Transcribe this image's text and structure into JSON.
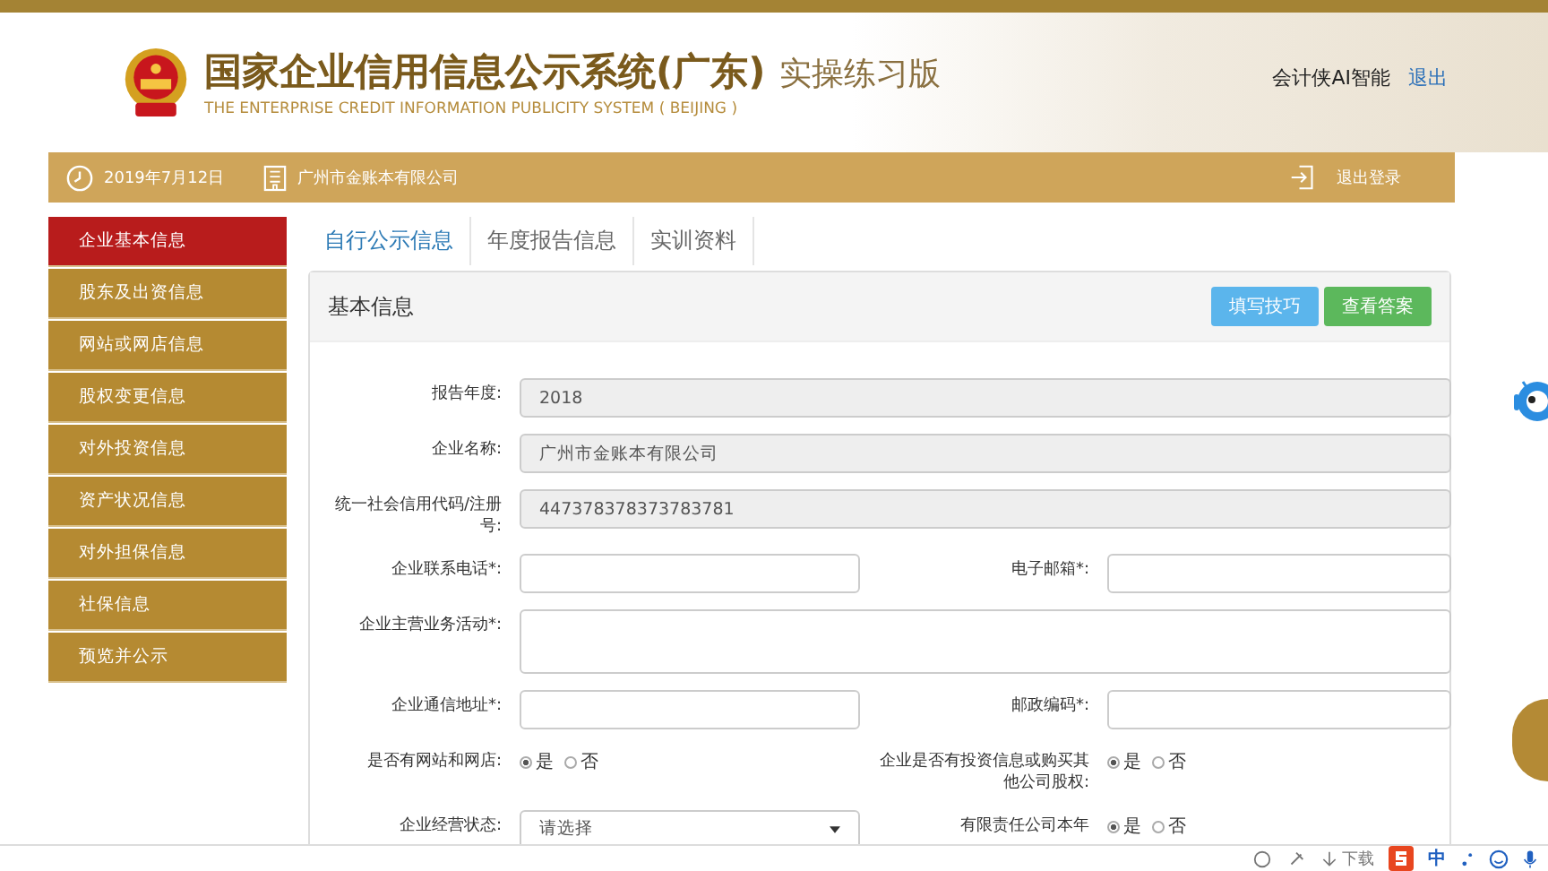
{
  "header": {
    "title": "国家企业信用信息公示系统",
    "region": "(广东)",
    "edition": "实操练习版",
    "english": "THE ENTERPRISE CREDIT INFORMATION PUBLICITY SYSTEM ( BEIJING )",
    "user": "会计侠AI智能",
    "logout": "退出"
  },
  "nav_bar": {
    "date": "2019年7月12日",
    "company": "广州市金账本有限公司",
    "logout": "退出登录"
  },
  "sidebar": {
    "items": [
      {
        "label": "企业基本信息",
        "selected": true
      },
      {
        "label": "股东及出资信息",
        "selected": false
      },
      {
        "label": "网站或网店信息",
        "selected": false
      },
      {
        "label": "股权变更信息",
        "selected": false
      },
      {
        "label": "对外投资信息",
        "selected": false
      },
      {
        "label": "资产状况信息",
        "selected": false
      },
      {
        "label": "对外担保信息",
        "selected": false
      },
      {
        "label": "社保信息",
        "selected": false
      },
      {
        "label": "预览并公示",
        "selected": false
      }
    ]
  },
  "tabs": [
    {
      "label": "自行公示信息",
      "selected": true
    },
    {
      "label": "年度报告信息",
      "selected": false
    },
    {
      "label": "实训资料",
      "selected": false
    }
  ],
  "card": {
    "title": "基本信息",
    "buttons": [
      {
        "label": "填写技巧",
        "kind": "info"
      },
      {
        "label": "查看答案",
        "kind": "success"
      }
    ],
    "fields": [
      {
        "label": "报告年度:",
        "kind": "readonly",
        "wide": true,
        "value": "2018"
      },
      {
        "label": "企业名称:",
        "kind": "readonly",
        "wide": true,
        "value": "广州市金账本有限公司"
      },
      {
        "label": "统一社会信用代码/注册号:",
        "kind": "readonly",
        "wide": true,
        "value": "447378378373783781"
      },
      {
        "label": "企业联系电话*:",
        "kind": "text",
        "wide": false
      },
      {
        "label": "电子邮箱*:",
        "kind": "text",
        "wide": false
      },
      {
        "label": "企业主营业务活动*:",
        "kind": "textarea",
        "wide": true
      },
      {
        "label": "企业通信地址*:",
        "kind": "text",
        "wide": false
      },
      {
        "label": "邮政编码*:",
        "kind": "text",
        "wide": false
      },
      {
        "label": "是否有网站和网店:",
        "kind": "radio",
        "wide": false,
        "options": [
          {
            "label": "是",
            "selected": true
          },
          {
            "label": "否",
            "selected": false
          }
        ]
      },
      {
        "label": "企业是否有投资信息或购买其他公司股权:",
        "kind": "radio",
        "wide": false,
        "options": [
          {
            "label": "是",
            "selected": true
          },
          {
            "label": "否",
            "selected": false
          }
        ]
      },
      {
        "label": "企业经营状态:",
        "kind": "select",
        "wide": false,
        "value": "请选择"
      },
      {
        "label": "有限责任公司本年",
        "kind": "radio",
        "wide": false,
        "options": [
          {
            "label": "是",
            "selected": true
          },
          {
            "label": "否",
            "selected": false
          }
        ]
      }
    ]
  },
  "bottom_bar": {
    "download": "下载",
    "ime": "中"
  }
}
